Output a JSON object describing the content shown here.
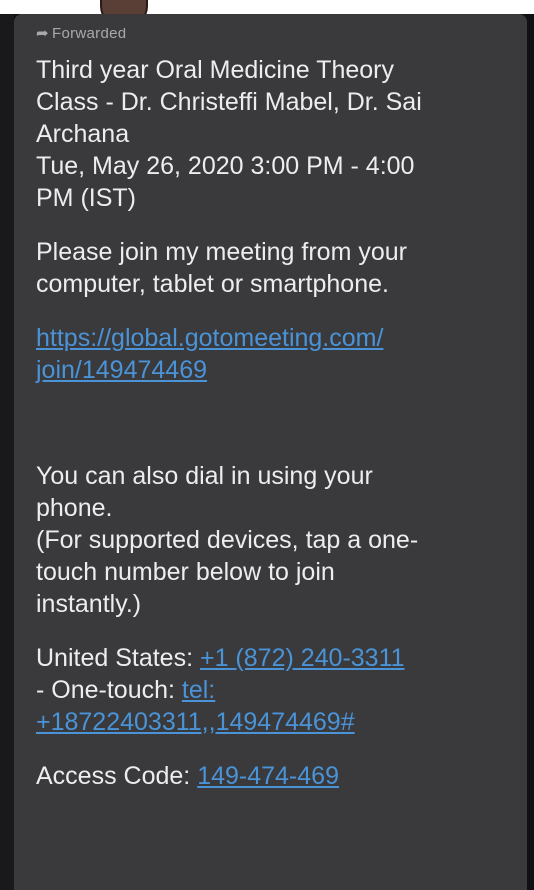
{
  "message": {
    "forwarded_label": "Forwarded",
    "title_lines": [
      "Third year Oral Medicine Theory",
      "Class - Dr. Christeffi Mabel, Dr. Sai",
      "Archana"
    ],
    "date_lines": [
      "Tue, May 26, 2020 3:00 PM - 4:00",
      "PM (IST)"
    ],
    "join_lines": [
      "Please join my meeting from your",
      "computer, tablet or smartphone."
    ],
    "meeting_link_lines": [
      "https://global.gotomeeting.com/",
      "join/149474469"
    ],
    "dial_lines": [
      "You can also dial in using your",
      "phone.",
      "(For supported devices, tap a one-",
      "touch number below to join",
      "instantly.)"
    ],
    "us_label": "United States: ",
    "us_number": "+1 (872) 240-3311",
    "onetouch_label": "- One-touch: ",
    "onetouch_link_1": "tel:",
    "onetouch_link_2": "+18722403311,,149474469#",
    "access_label": "Access Code: ",
    "access_code": "149-474-469"
  },
  "colors": {
    "bubble": "#3a3a3d",
    "link": "#4a93d6",
    "text": "#ededed"
  }
}
